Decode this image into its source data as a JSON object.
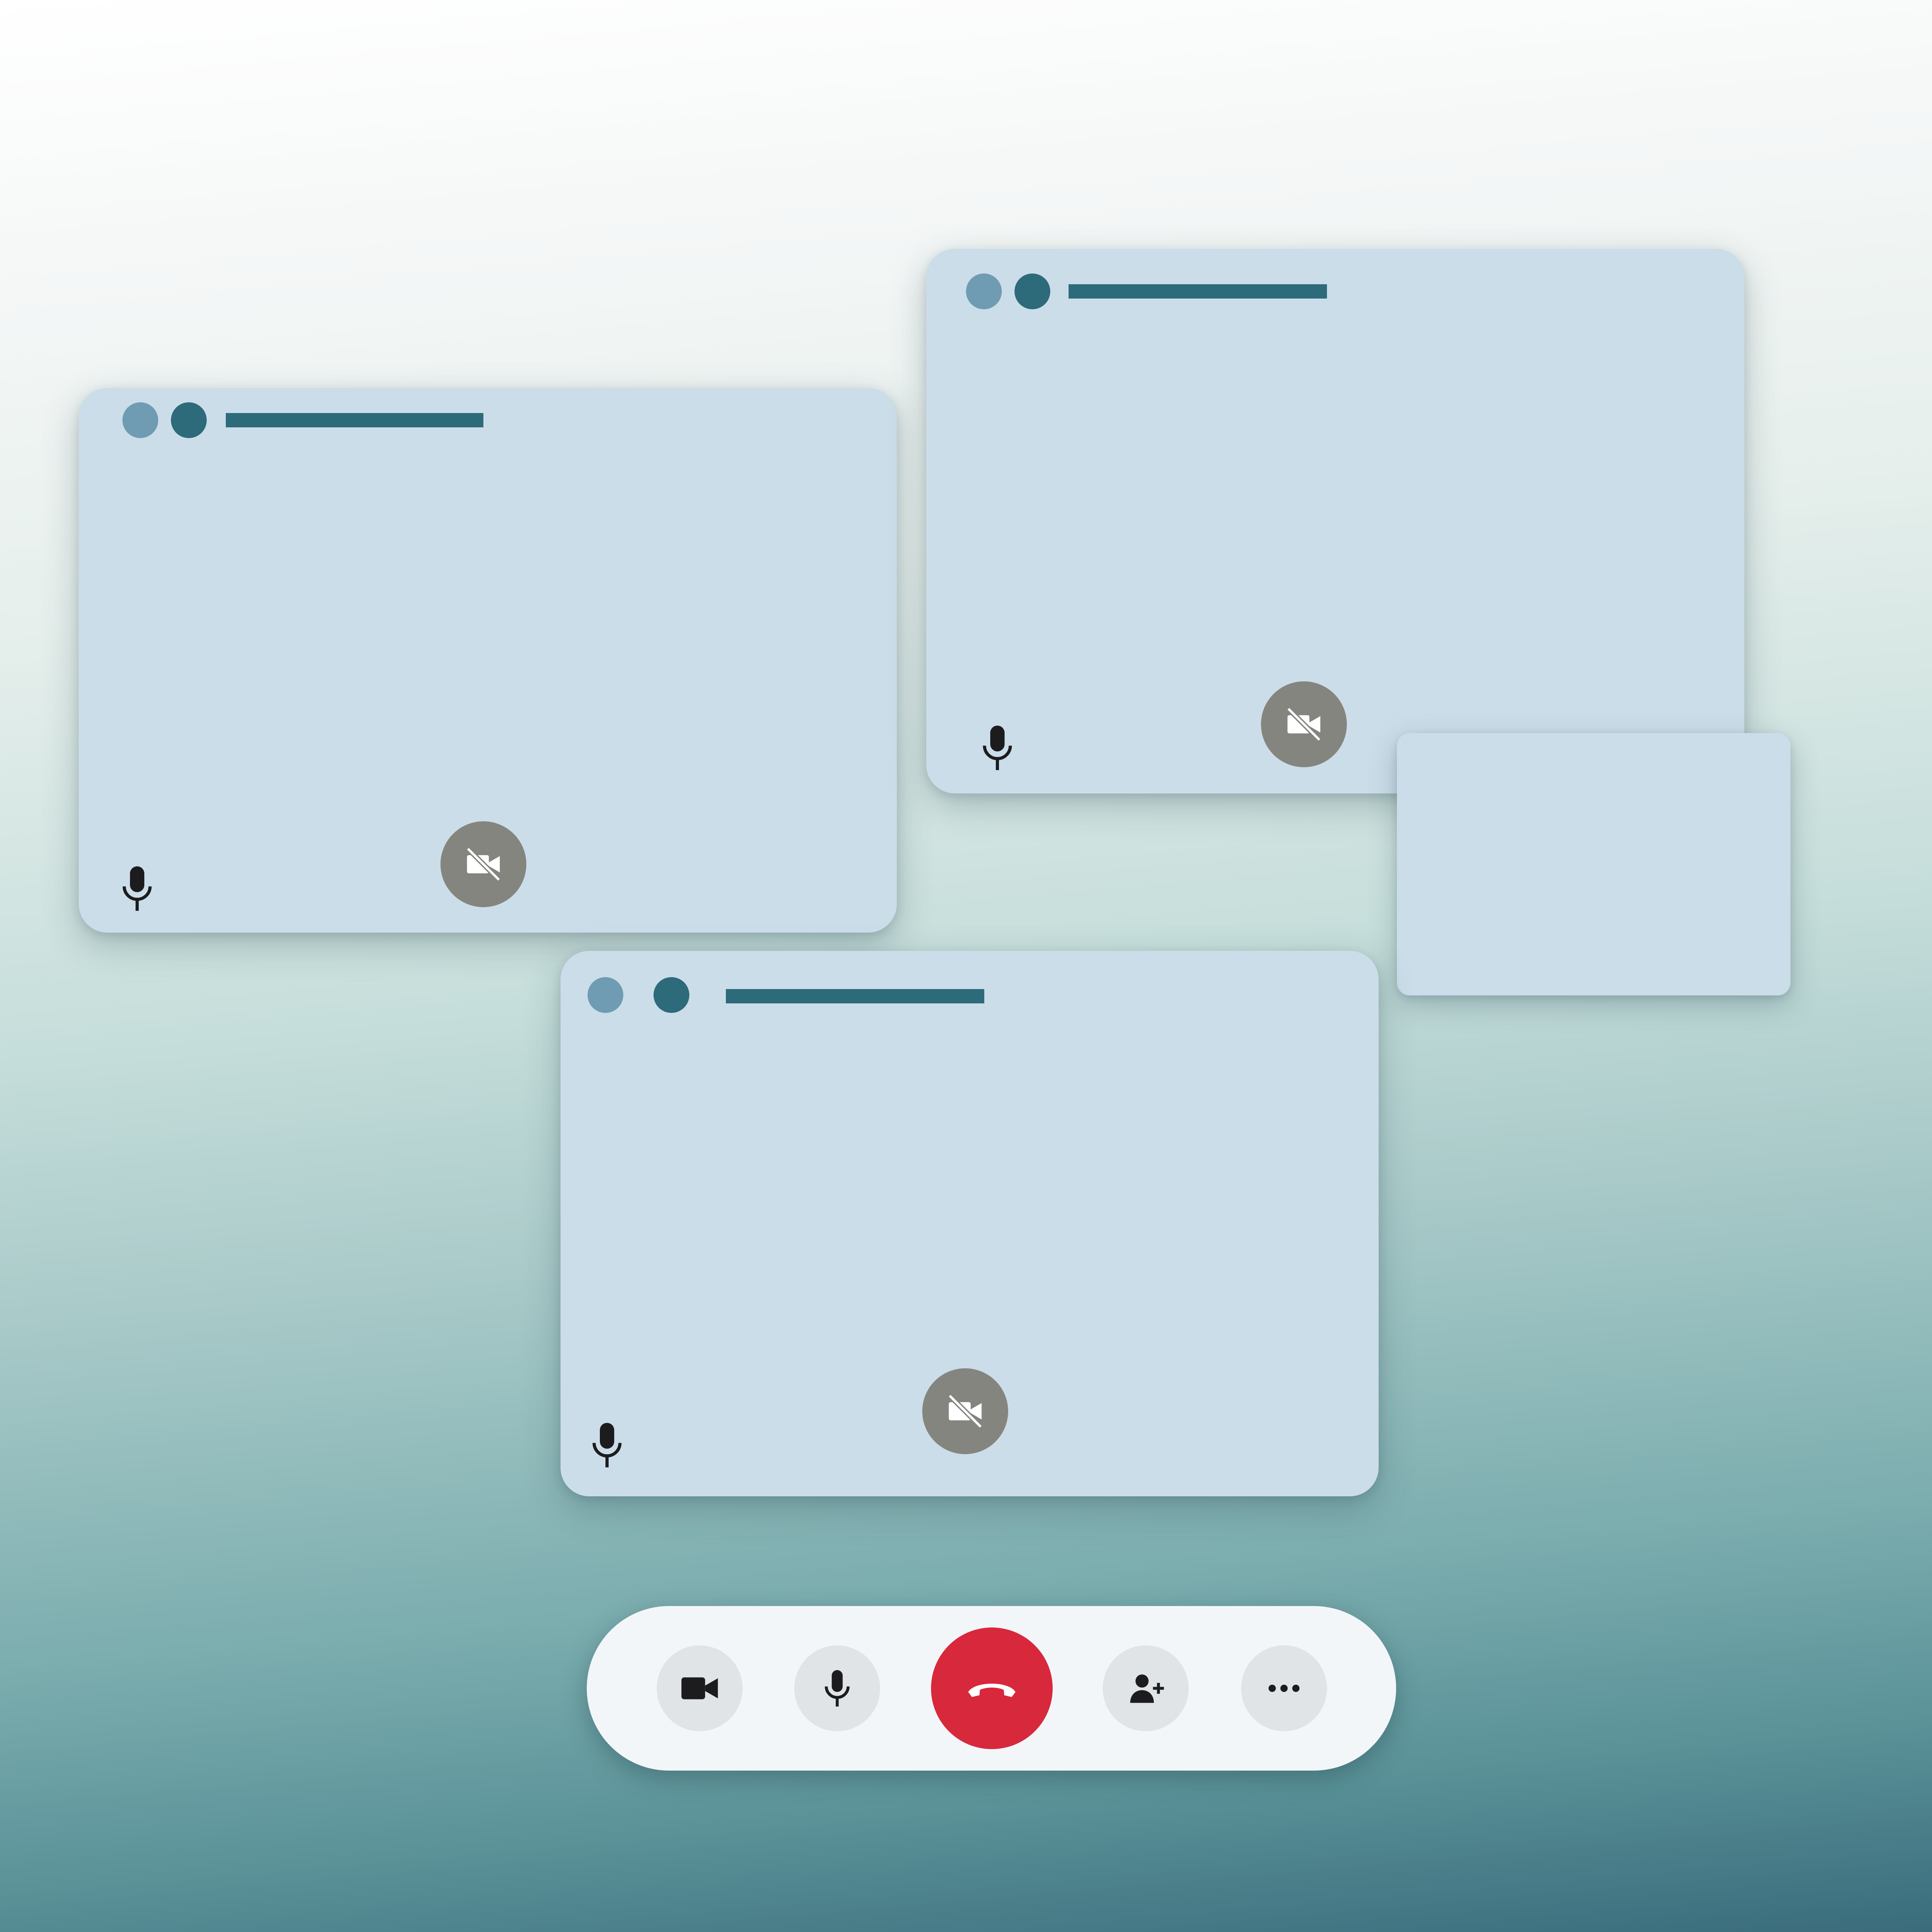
{
  "colors": {
    "window_bg": "#cbdde9",
    "dot_light": "#6f9bb3",
    "dot_dark": "#2d6a7a",
    "title_bar": "#2d6a7a",
    "camera_off_bg": "#858580",
    "toolbar_bg": "#f3f6f9",
    "toolbar_button_bg": "#e1e4e6",
    "end_call": "#d8283c"
  },
  "windows": [
    {
      "name": "participant-window-1",
      "mic_icon": "microphone-icon",
      "camera_icon": "video-off-icon"
    },
    {
      "name": "participant-window-2",
      "mic_icon": "microphone-icon",
      "camera_icon": "video-off-icon"
    },
    {
      "name": "participant-window-3",
      "mic_icon": "microphone-icon",
      "camera_icon": "video-off-icon"
    },
    {
      "name": "self-view-window"
    }
  ],
  "toolbar": {
    "buttons": [
      {
        "name": "camera-button",
        "icon": "video-camera-icon"
      },
      {
        "name": "microphone-button",
        "icon": "microphone-icon"
      },
      {
        "name": "end-call-button",
        "icon": "phone-hangup-icon"
      },
      {
        "name": "add-participant-button",
        "icon": "person-add-icon"
      },
      {
        "name": "more-options-button",
        "icon": "more-horizontal-icon"
      }
    ]
  }
}
